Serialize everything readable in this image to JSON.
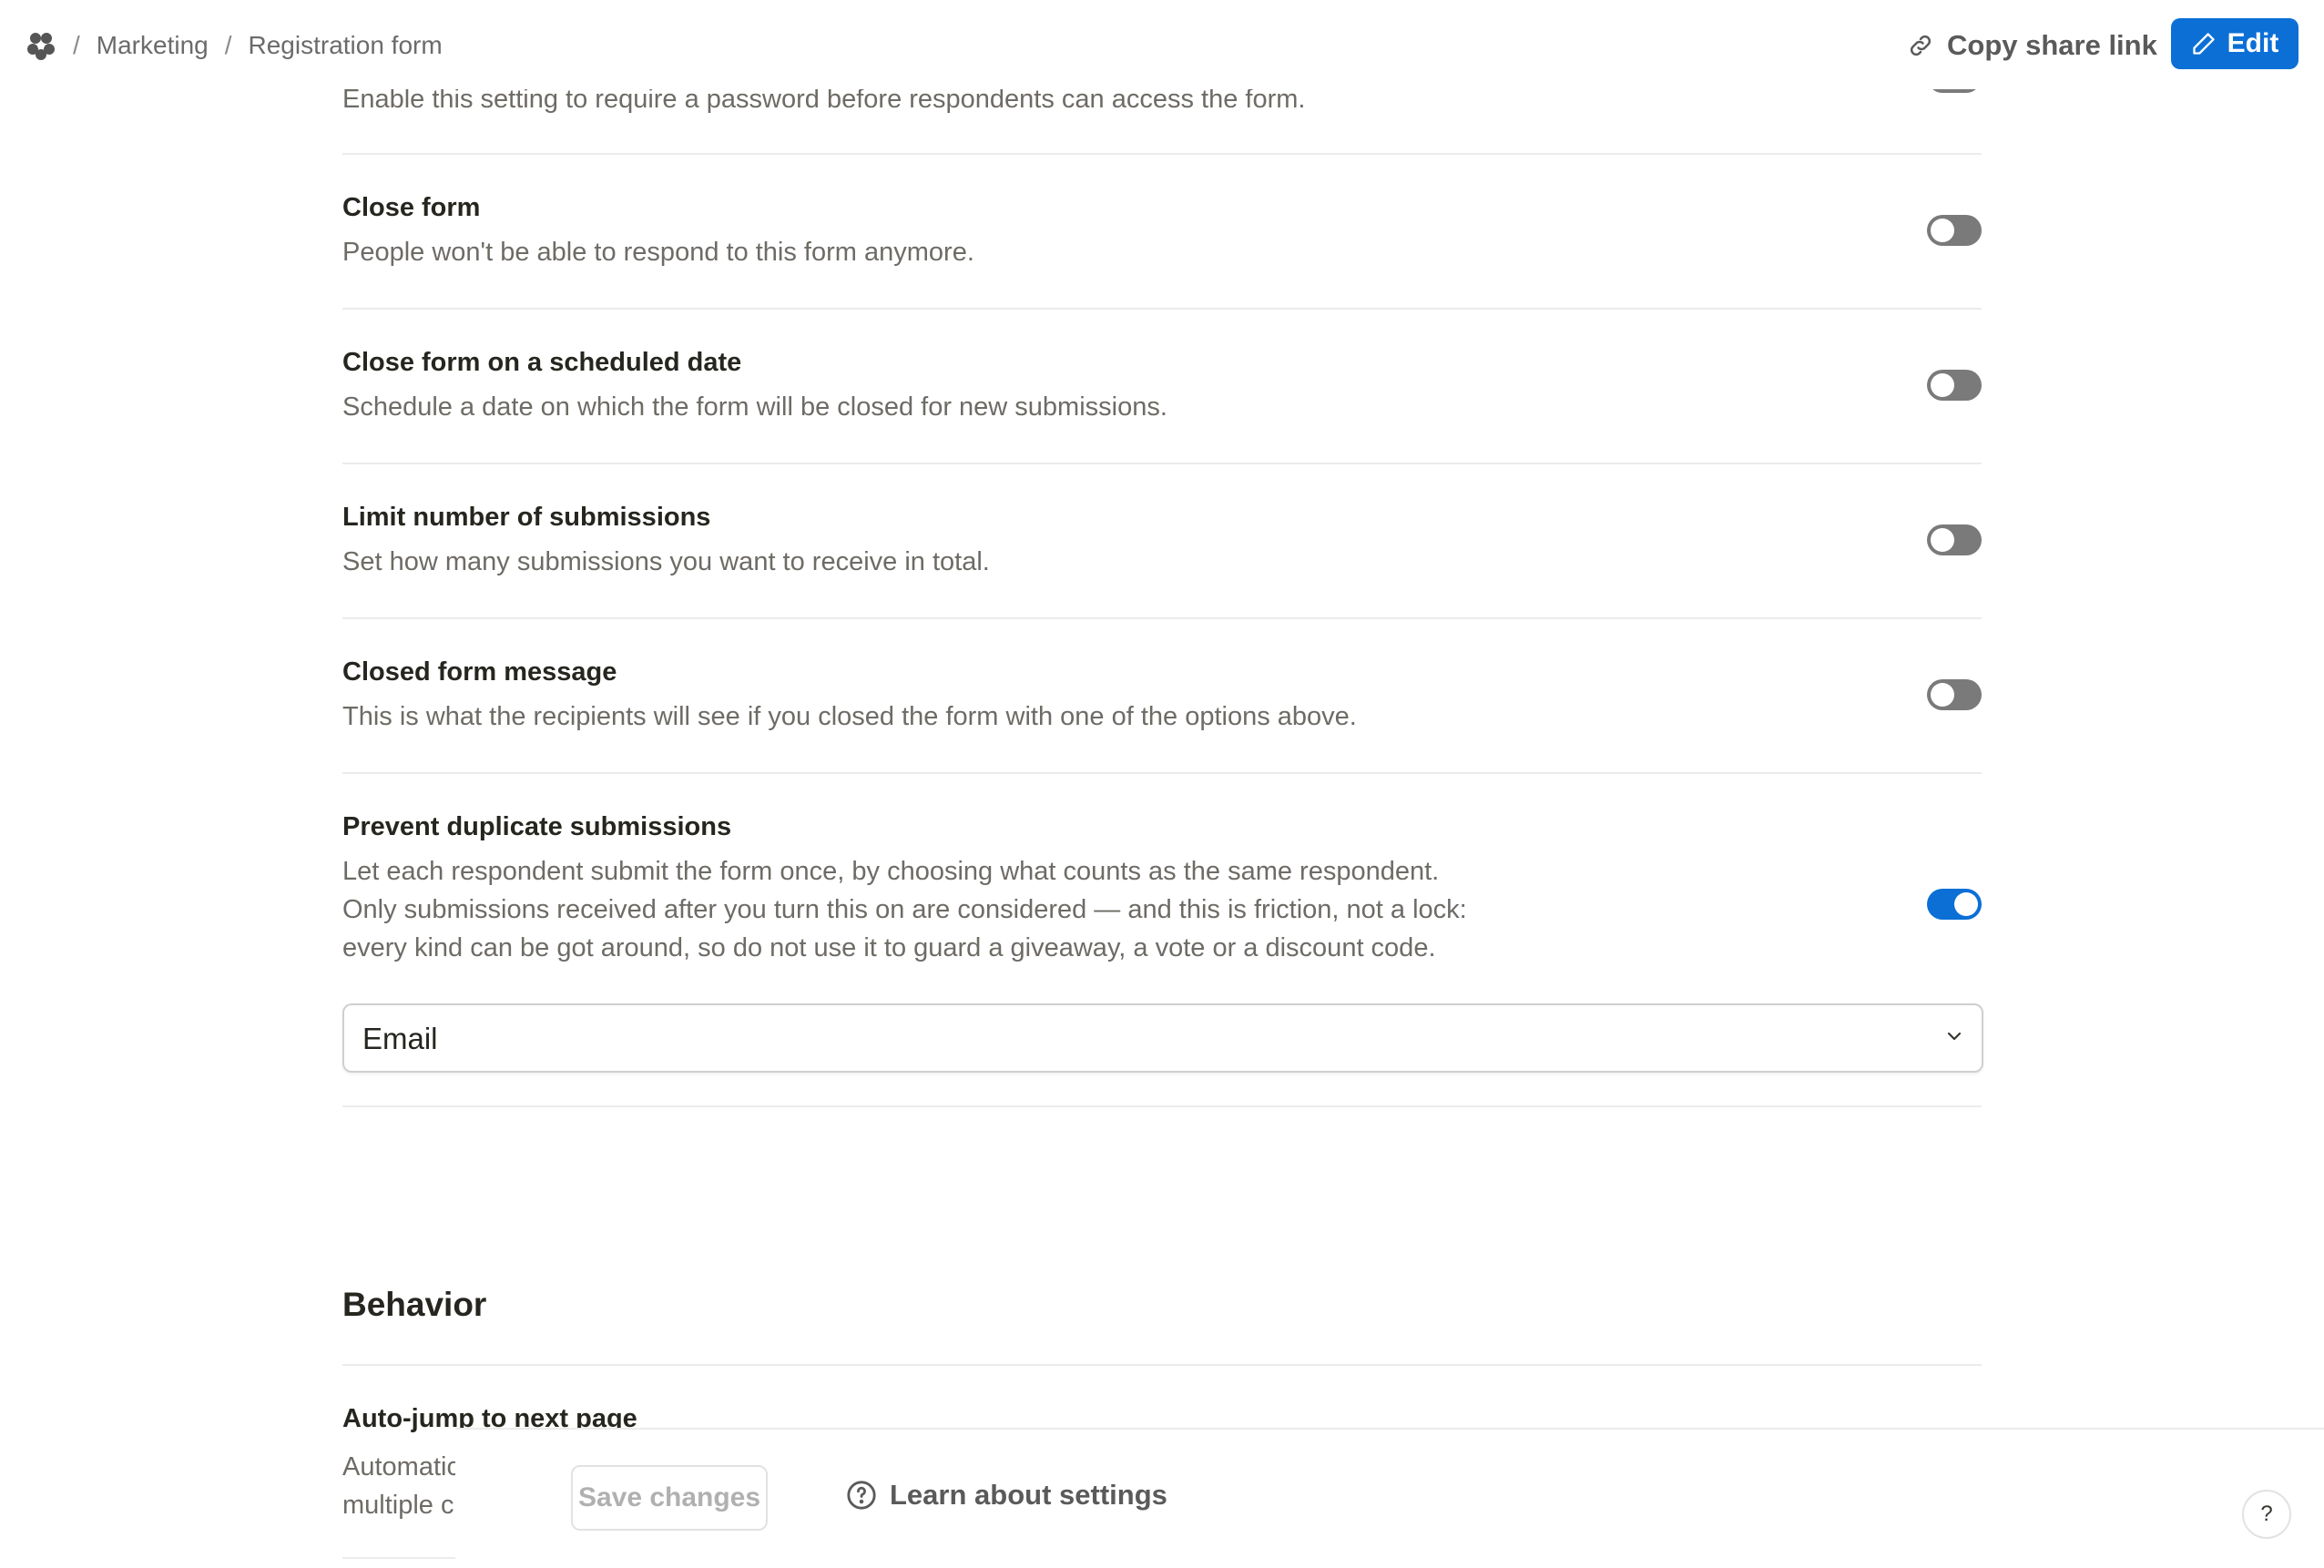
{
  "breadcrumb": {
    "items": [
      "Marketing",
      "Registration form"
    ],
    "separator": "/"
  },
  "header": {
    "share_label": "Copy share link",
    "edit_label": "Edit"
  },
  "settings": [
    {
      "title": "",
      "description": "Enable this setting to require a password before respondents can access the form.",
      "enabled": false
    },
    {
      "title": "Close form",
      "description": "People won't be able to respond to this form anymore.",
      "enabled": false
    },
    {
      "title": "Close form on a scheduled date",
      "description": "Schedule a date on which the form will be closed for new submissions.",
      "enabled": false
    },
    {
      "title": "Limit number of submissions",
      "description": "Set how many submissions you want to receive in total.",
      "enabled": false
    },
    {
      "title": "Closed form message",
      "description": "This is what the recipients will see if you closed the form with one of the options above.",
      "enabled": false
    },
    {
      "title": "Prevent duplicate submissions",
      "description_lines": [
        "Let each respondent submit the form once, by choosing what counts as the same respondent.",
        "Only submissions received after you turn this on are considered — and this is friction, not a lock:",
        "every kind can be got around, so do not use it to guard a giveaway, a vote or a discount code."
      ],
      "enabled": true
    }
  ],
  "duplicate_select": {
    "value": "Email"
  },
  "behavior": {
    "heading": "Behavior",
    "first_item_title": "Auto-jump to next page",
    "first_item_desc_lines": [
      "Automatic",
      "multiple c"
    ]
  },
  "footer": {
    "save_label": "Save changes",
    "learn_label": "Learn about settings",
    "help_label": "?"
  },
  "colors": {
    "accent": "#0b6fd6",
    "toggle_off": "#7a7a7a",
    "text": "#26251f",
    "muted": "#6e6b66"
  }
}
